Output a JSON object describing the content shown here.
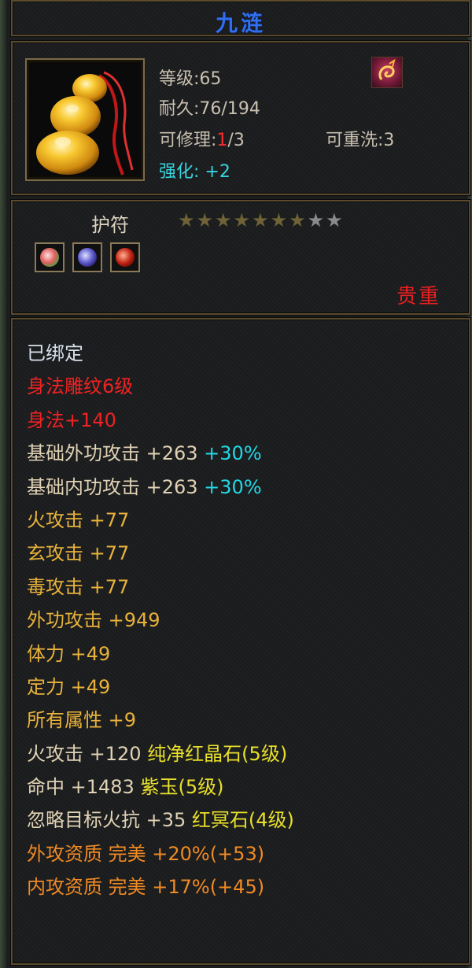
{
  "item": {
    "name": "九涟",
    "level": "等级:65",
    "durability": "耐久:76/194",
    "repair_label": "可修理:",
    "repair_current": "1",
    "repair_max": "/3",
    "rewash": "可重洗:3",
    "enhance": "强化: +2",
    "type": "护符",
    "rarity": "贵重",
    "stars_filled": "★★★★★★★",
    "stars_empty": "★★"
  },
  "attributes": [
    {
      "text": "已绑定"
    },
    {
      "text": "身法雕纹6级"
    },
    {
      "text": "身法+140"
    },
    {
      "text": "基础外功攻击 +263",
      "extra": " +30%"
    },
    {
      "text": "基础内功攻击 +263",
      "extra": " +30%"
    },
    {
      "text": "火攻击 +77"
    },
    {
      "text": "玄攻击 +77"
    },
    {
      "text": "毒攻击 +77"
    },
    {
      "text": "外功攻击 +949"
    },
    {
      "text": "体力 +49"
    },
    {
      "text": "定力 +49"
    },
    {
      "text": "所有属性 +9"
    },
    {
      "text": "火攻击 +120 ",
      "extra": "纯净红晶石(5级)"
    },
    {
      "text": "命中 +1483 ",
      "extra": "紫玉(5级)"
    },
    {
      "text": "忽略目标火抗 +35 ",
      "extra": "红冥石(4级)"
    },
    {
      "text": "外攻资质 完美 +20%(+53)"
    },
    {
      "text": "内攻资质 完美 +17%(+45)"
    }
  ],
  "icons": {
    "item": "jade-gourd-pendant-icon",
    "badge": "enhance-emblem-icon",
    "gems": [
      "pink-gem-icon",
      "purple-gem-icon",
      "red-gem-icon"
    ]
  },
  "colors": {
    "title": "#2f6ff0",
    "bound": "#d8e0ea",
    "engrave": "#f02222",
    "base_attack": "#e0d2b4",
    "bonus": "#e8b23a",
    "percent": "#22d8e6",
    "gem_name": "#e8e02a",
    "quality": "#f08a24",
    "rarity": "#e82020"
  }
}
